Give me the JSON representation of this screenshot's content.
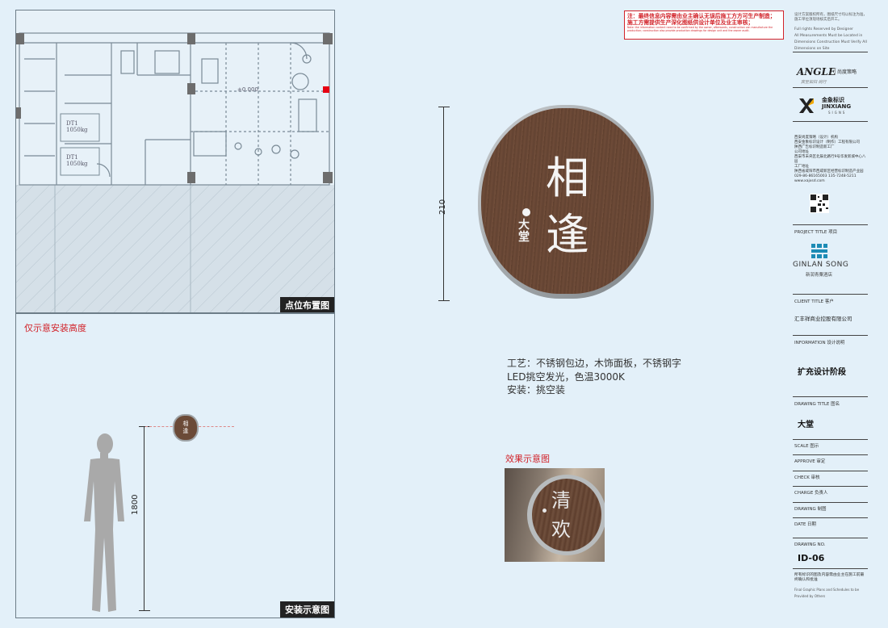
{
  "panels": {
    "plan_label": "点位布置图",
    "install_label": "安装示意图",
    "height_note": "仅示意安装高度",
    "elevation_mark": "±0.000",
    "elevator_1": "DT1\n1050kg",
    "elevator_2": "DT1\n1050kg"
  },
  "sign": {
    "title_char_1": "相",
    "title_char_2": "逢",
    "subtitle": "大堂",
    "dimension": "210"
  },
  "install": {
    "height_dim": "1800",
    "mini_char_1": "相",
    "mini_char_2": "逢"
  },
  "specs": {
    "line1": "工艺：不锈钢包边，木饰面板，不锈钢字",
    "line2": "LED挑空发光，色温3000K",
    "line3": "安装：挑空装"
  },
  "effect": {
    "label": "效果示意图",
    "char_1": "清",
    "char_2": "欢"
  },
  "notice": {
    "line1": "注：最终信息内容需由业主确认无误后施工方方可生产制造；",
    "line2": "施工方需提供生产深化图纸供设计单位及业主审核；",
    "english": "Note: the information content need to be confirmed by the owner, afterwards, construction can manufacture the production; construction also provide production drawings for design unit and the owner audit."
  },
  "title_block": {
    "top_note_1": "设计方案版权所有，图纸尺寸均以标注为准，施工单位须现场核实后开工。",
    "top_note_2": "Full rights Reserved by Designer",
    "top_note_3": "All Measurements Must be Located in",
    "top_note_4": "Dimensions Construction Must Verify All",
    "top_note_5": "Dimensions on Site",
    "brand_1": "ANGLE",
    "brand_1_cn": "尚度策略",
    "brand_1_slogan": "宾至如归 尚行",
    "brand_2_cn": "金象标识",
    "brand_2_en": "JINXIANG",
    "brand_2_sub": "SIGNS",
    "company_1": "西安尚度策略（设计）机构",
    "company_2": "西安金象标识设计（制作）工程有限公司",
    "company_3": "陕西广告标识制造新工厂",
    "address_label": "公司地址",
    "address_1": "西安市未央区北辰北路行9号华发新城中心八层",
    "factory_label": "工厂地址",
    "factory_1": "陕西省咸阳市西咸新区经营标识制造产业园",
    "phone": "029-86-86165003  135-7248-5211",
    "web": "www.xajxsd.com",
    "project_title_label": "PROJECT TITLE 项目",
    "project_name_en": "GINLAN SONG",
    "project_name_cn": "新润青粟酒店",
    "client_title_label": "CLIENT TITLE 客户",
    "client_name": "汇丰祥商业控股有限公司",
    "information_label": "INFORMATION 设计说明",
    "information_value": "扩充设计阶段",
    "drawing_title_label": "DRAWING TITLE 图名",
    "drawing_title_value": "大堂",
    "scale_label": "SCALE 图示",
    "approve_label": "APPROVE 审定",
    "check_label": "CHECK 审核",
    "charge_label": "CHARGE 负责人",
    "drawing_label": "DRAWING 制图",
    "date_label": "DATE 日期",
    "drawing_no_label": "DRAWING NO.",
    "drawing_no_value": "ID-06",
    "footer_1": "所有标识的图及内容需由业主在施工前最终确认和批准",
    "footer_2": "Final Graphic Plans and Schedules to be",
    "footer_3": "Provided by Others"
  },
  "colors": {
    "background": "#e3f0f9",
    "wood": "#6b4a37",
    "accent_red": "#d2232a"
  }
}
